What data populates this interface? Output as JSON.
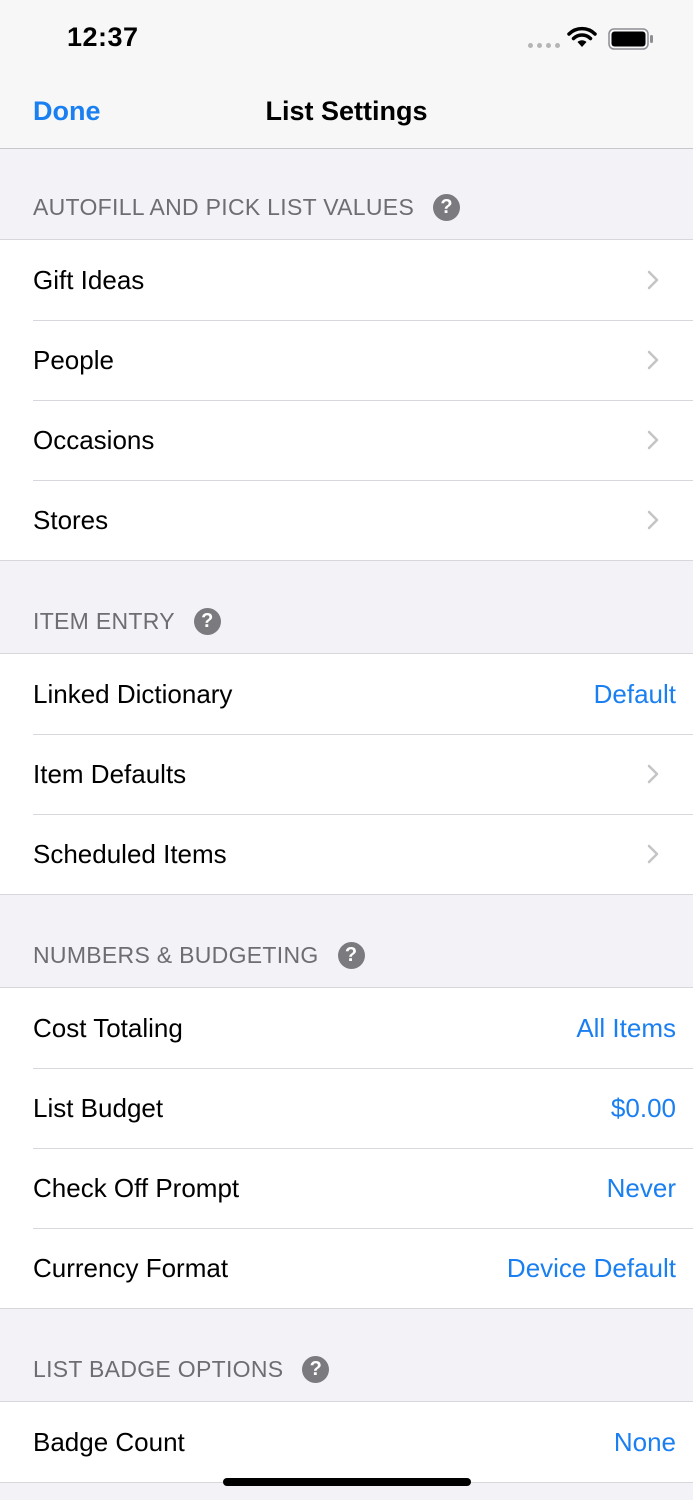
{
  "status_bar": {
    "time": "12:37"
  },
  "nav": {
    "done_label": "Done",
    "title": "List Settings"
  },
  "sections": [
    {
      "header": "AUTOFILL AND PICK LIST VALUES",
      "rows": [
        {
          "label": "Gift Ideas"
        },
        {
          "label": "People"
        },
        {
          "label": "Occasions"
        },
        {
          "label": "Stores"
        }
      ]
    },
    {
      "header": "ITEM ENTRY",
      "rows": [
        {
          "label": "Linked Dictionary",
          "value": "Default"
        },
        {
          "label": "Item Defaults"
        },
        {
          "label": "Scheduled Items"
        }
      ]
    },
    {
      "header": "NUMBERS & BUDGETING",
      "rows": [
        {
          "label": "Cost Totaling",
          "value": "All Items"
        },
        {
          "label": "List Budget",
          "value": "$0.00"
        },
        {
          "label": "Check Off Prompt",
          "value": "Never"
        },
        {
          "label": "Currency Format",
          "value": "Device Default"
        }
      ]
    },
    {
      "header": "LIST BADGE OPTIONS",
      "rows": [
        {
          "label": "Badge Count",
          "value": "None"
        }
      ]
    }
  ],
  "colors": {
    "accent": "#1a7ff0",
    "background": "#f2f2f7",
    "header_text": "#6d6d72"
  }
}
